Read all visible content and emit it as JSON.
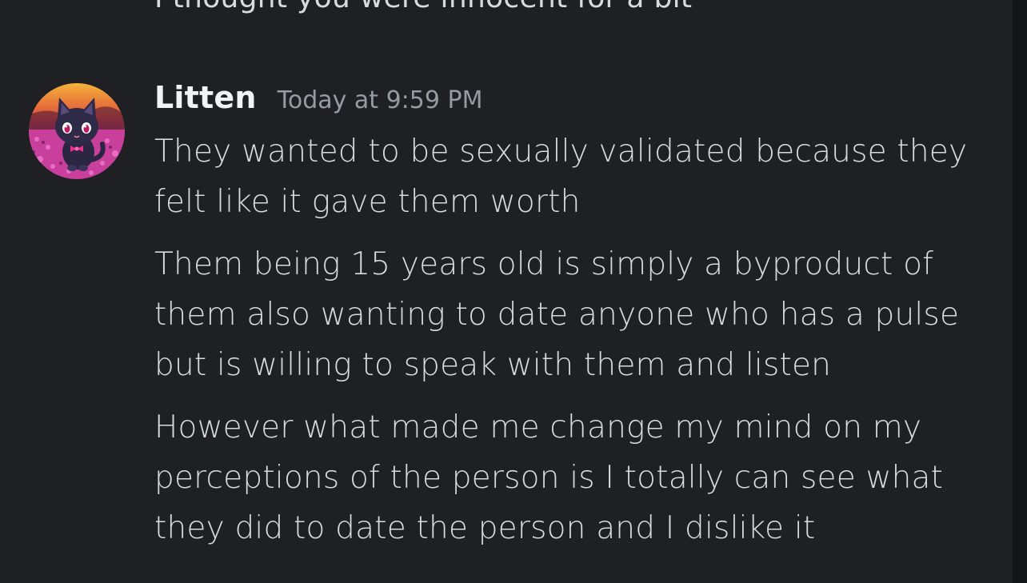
{
  "chat": {
    "previous_message": "I thought you were innocent for a bit",
    "author": {
      "name": "Litten",
      "timestamp": "Today at 9:59 PM",
      "avatar_icon": "black-cat-avatar-icon"
    },
    "messages": [
      {
        "text": "They wanted to be sexually validated because they felt like it gave them worth"
      },
      {
        "text": "Them being 15 years old is simply a byproduct of them also wanting to date anyone who has a pulse but is willing to speak with them and listen"
      },
      {
        "text": "However what made me change my mind on my perceptions of the person is I totally can see what they did to date the person and I dislike it"
      }
    ]
  },
  "theme": {
    "background": "#1f2024",
    "text": "#d9dae0",
    "username": "#f2f3f5",
    "timestamp": "#969aa3"
  }
}
